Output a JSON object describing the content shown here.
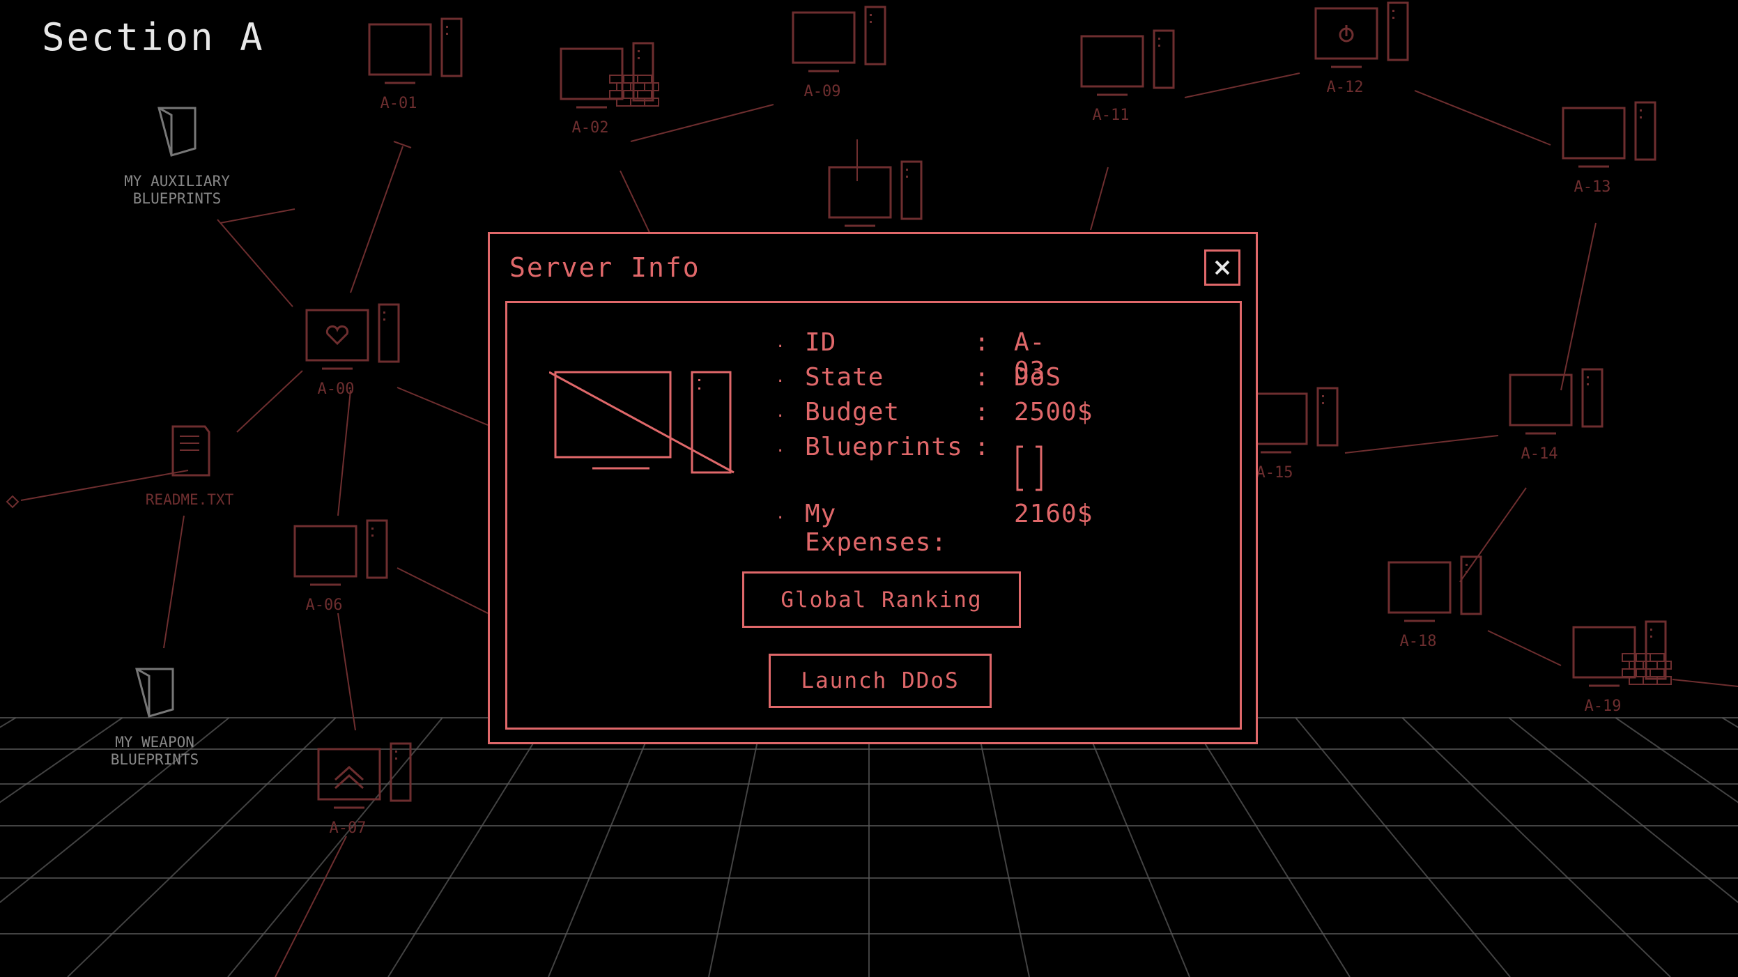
{
  "section_title": "Section A",
  "colors": {
    "accent": "#e0686a",
    "dim": "#6e2e2f",
    "grid": "#5a5a5a",
    "background": "#000000"
  },
  "folders": [
    {
      "label_lines": [
        "MY AUXILIARY",
        "BLUEPRINTS"
      ],
      "icon": "folder-icon"
    },
    {
      "label_lines": [
        "README.TXT"
      ],
      "icon": "text-file-icon"
    },
    {
      "label_lines": [
        "MY WEAPON",
        "BLUEPRINTS"
      ],
      "icon": "folder-icon"
    }
  ],
  "nodes": [
    {
      "label": "A-01",
      "icon": "computer-icon"
    },
    {
      "label": "A-02",
      "icon": "firewall-computer-icon"
    },
    {
      "label": "A-09",
      "icon": "computer-icon"
    },
    {
      "label": "A-11",
      "icon": "computer-icon"
    },
    {
      "label": "A-12",
      "icon": "power-computer-icon"
    },
    {
      "label": "A-13",
      "icon": "computer-icon"
    },
    {
      "label": "A-00",
      "icon": "heart-computer-icon"
    },
    {
      "label": "A-06",
      "icon": "computer-icon"
    },
    {
      "label": "A-07",
      "icon": "upload-computer-icon"
    },
    {
      "label": "A-15",
      "icon": "computer-icon"
    },
    {
      "label": "A-14",
      "icon": "computer-icon"
    },
    {
      "label": "A-18",
      "icon": "computer-icon"
    },
    {
      "label": "A-19",
      "icon": "firewall-computer-icon"
    },
    {
      "label": "",
      "icon": "computer-icon"
    }
  ],
  "modal": {
    "title": "Server Info",
    "close_icon": "close-icon",
    "rows": [
      {
        "key": "ID",
        "value": "A-03"
      },
      {
        "key": "State",
        "value": "DoS"
      },
      {
        "key": "Budget",
        "value": "2500$"
      },
      {
        "key": "Blueprints",
        "value": ""
      },
      {
        "key": "My Expenses:",
        "value": "2160$"
      }
    ],
    "buttons": {
      "ranking": "Global Ranking",
      "ddos": "Launch DDoS"
    }
  }
}
